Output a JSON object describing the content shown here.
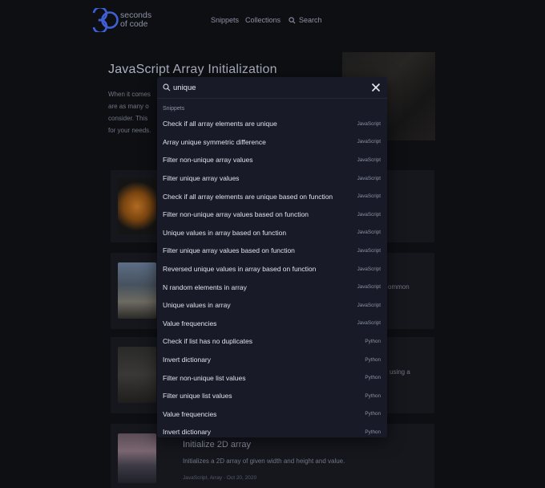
{
  "header": {
    "logo_line1": "seconds",
    "logo_line2": "of code",
    "nav_snippets": "Snippets",
    "nav_collections": "Collections",
    "nav_search": "Search"
  },
  "background": {
    "page_title": "JavaScript Array Initialization",
    "desc_lines": [
      "When it comes",
      "are as many o",
      "consider. This",
      "for your needs."
    ],
    "peek_right_1": "ommon",
    "peek_right_2": "using a",
    "last_card": {
      "title": "Initialize 2D array",
      "description": "Initializes a 2D array of given width and height and value.",
      "meta": "JavaScript, Array · Oct 20, 2020"
    }
  },
  "search": {
    "query": "unique",
    "section_label": "Snippets",
    "results": [
      {
        "title": "Check if all array elements are unique",
        "lang": "JavaScript"
      },
      {
        "title": "Array unique symmetric difference",
        "lang": "JavaScript"
      },
      {
        "title": "Filter non-unique array values",
        "lang": "JavaScript"
      },
      {
        "title": "Filter unique array values",
        "lang": "JavaScript"
      },
      {
        "title": "Check if all array elements are unique based on function",
        "lang": "JavaScript"
      },
      {
        "title": "Filter non-unique array values based on function",
        "lang": "JavaScript"
      },
      {
        "title": "Unique values in array based on function",
        "lang": "JavaScript"
      },
      {
        "title": "Filter unique array values based on function",
        "lang": "JavaScript"
      },
      {
        "title": "Reversed unique values in array based on function",
        "lang": "JavaScript"
      },
      {
        "title": "N random elements in array",
        "lang": "JavaScript"
      },
      {
        "title": "Unique values in array",
        "lang": "JavaScript"
      },
      {
        "title": "Value frequencies",
        "lang": "JavaScript"
      },
      {
        "title": "Check if list has no duplicates",
        "lang": "Python"
      },
      {
        "title": "Invert dictionary",
        "lang": "Python"
      },
      {
        "title": "Filter non-unique list values",
        "lang": "Python"
      },
      {
        "title": "Filter unique list values",
        "lang": "Python"
      },
      {
        "title": "Value frequencies",
        "lang": "Python"
      },
      {
        "title": "Invert dictionary",
        "lang": "Python"
      }
    ]
  }
}
